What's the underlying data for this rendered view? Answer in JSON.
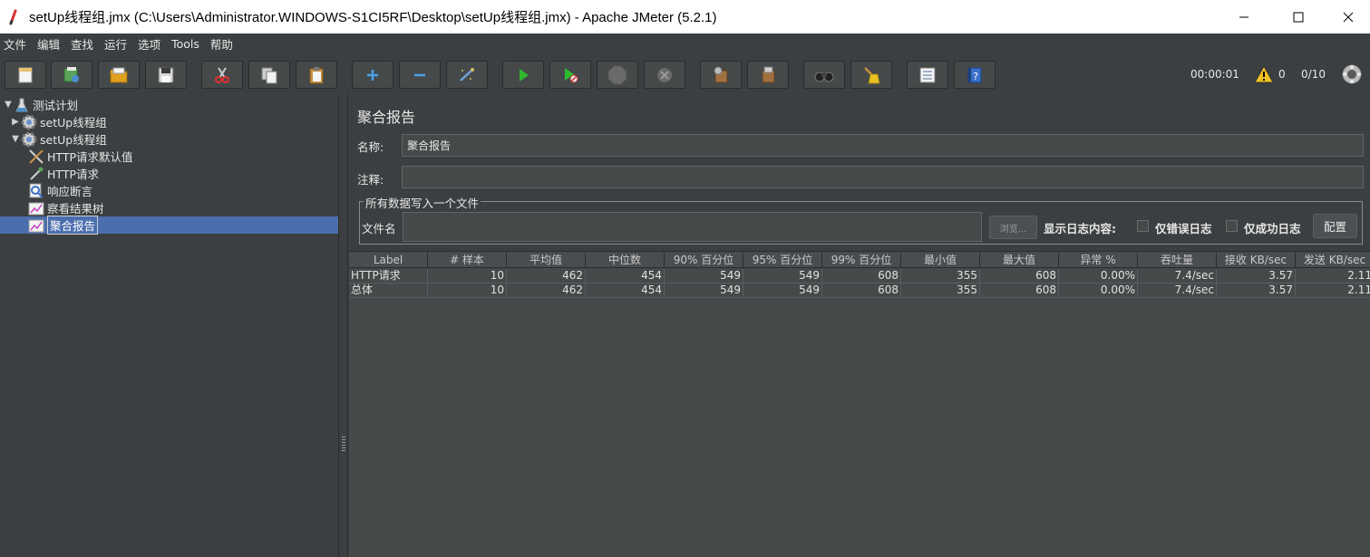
{
  "window": {
    "title": "setUp线程组.jmx (C:\\Users\\Administrator.WINDOWS-S1CI5RF\\Desktop\\setUp线程组.jmx) - Apache JMeter (5.2.1)"
  },
  "menu": [
    "文件",
    "编辑",
    "查找",
    "运行",
    "选项",
    "Tools",
    "帮助"
  ],
  "status": {
    "elapsed": "00:00:01",
    "warnings": "0",
    "threads": "0/10"
  },
  "tree": {
    "items": [
      {
        "label": "测试计划"
      },
      {
        "label": "setUp线程组"
      },
      {
        "label": "setUp线程组"
      },
      {
        "label": "HTTP请求默认值"
      },
      {
        "label": "HTTP请求"
      },
      {
        "label": "响应断言"
      },
      {
        "label": "察看结果树"
      },
      {
        "label": "聚合报告"
      }
    ]
  },
  "panel": {
    "title": "聚合报告",
    "name_label": "名称:",
    "name_value": "聚合报告",
    "comment_label": "注释:",
    "comment_value": "",
    "file_section": "所有数据写入一个文件",
    "filename_label": "文件名",
    "filename_value": "",
    "browse_label": "浏览...",
    "log_label": "显示日志内容:",
    "errors_only": "仅错误日志",
    "success_only": "仅成功日志",
    "configure": "配置"
  },
  "table": {
    "headers": [
      "Label",
      "# 样本",
      "平均值",
      "中位数",
      "90% 百分位",
      "95% 百分位",
      "99% 百分位",
      "最小值",
      "最大值",
      "异常 %",
      "吞吐量",
      "接收 KB/sec",
      "发送 KB/sec"
    ],
    "rows": [
      [
        "HTTP请求",
        "10",
        "462",
        "454",
        "549",
        "549",
        "608",
        "355",
        "608",
        "0.00%",
        "7.4/sec",
        "3.57",
        "2.11"
      ],
      [
        "总体",
        "10",
        "462",
        "454",
        "549",
        "549",
        "608",
        "355",
        "608",
        "0.00%",
        "7.4/sec",
        "3.57",
        "2.11"
      ]
    ]
  }
}
